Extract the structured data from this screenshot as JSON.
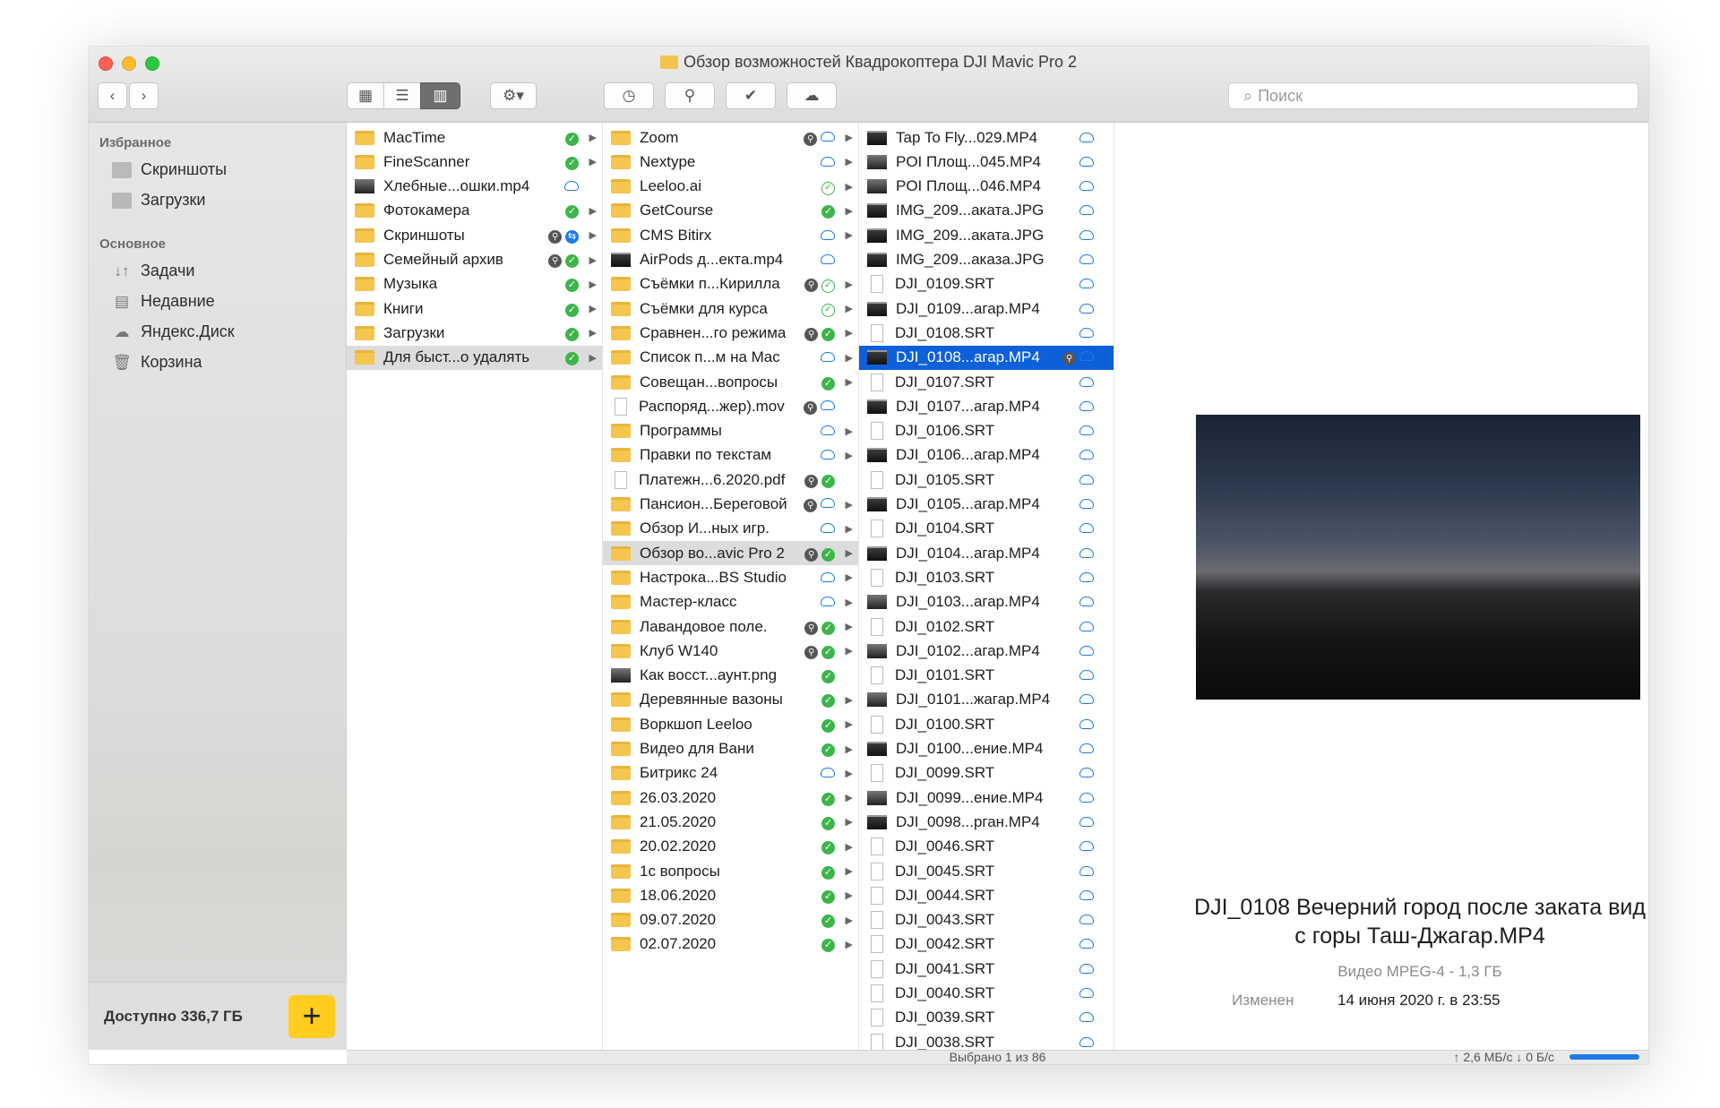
{
  "window": {
    "title": "Обзор возможностей Квадрокоптера DJI Mavic Pro 2"
  },
  "toolbar": {
    "back_icon": "chevron-left-icon",
    "forward_icon": "chevron-right-icon",
    "view_icons": "grid-icon",
    "view_list": "list-icon",
    "view_columns": "columns-icon",
    "action": "gear-icon",
    "search_placeholder": "Поиск"
  },
  "sidebar": {
    "favorites_header": "Избранное",
    "favorites": [
      {
        "label": "Скриншоты"
      },
      {
        "label": "Загрузки"
      }
    ],
    "main_header": "Основное",
    "main": [
      {
        "label": "Задачи",
        "icon": "↓↑"
      },
      {
        "label": "Недавние",
        "icon": "▤"
      },
      {
        "label": "Яндекс.Диск",
        "icon": "☁"
      },
      {
        "label": "Корзина",
        "icon": "🗑"
      }
    ],
    "free_space": "Доступно 336,7 ГБ",
    "add_label": "+"
  },
  "col1": [
    {
      "name": "MacTime",
      "type": "folder",
      "status": "ok",
      "arrow": true
    },
    {
      "name": "FineScanner",
      "type": "folder",
      "status": "ok",
      "arrow": true
    },
    {
      "name": "Хлебные...ошки.mp4",
      "type": "img",
      "status": "cloud",
      "arrow": false
    },
    {
      "name": "Фотокамера",
      "type": "folder",
      "status": "ok",
      "arrow": true
    },
    {
      "name": "Скриншоты",
      "type": "folder",
      "status": "linksync",
      "arrow": true
    },
    {
      "name": "Семейный архив",
      "type": "folder",
      "status": "linkok",
      "arrow": true
    },
    {
      "name": "Музыка",
      "type": "folder",
      "status": "ok",
      "arrow": true
    },
    {
      "name": "Книги",
      "type": "folder",
      "status": "ok",
      "arrow": true
    },
    {
      "name": "Загрузки",
      "type": "folder",
      "status": "ok",
      "arrow": true
    },
    {
      "name": "Для быст...о удалять",
      "type": "folder",
      "status": "ok",
      "arrow": true,
      "selected": true
    }
  ],
  "col2": [
    {
      "name": "Zoom",
      "type": "folder",
      "status": "linkcloud",
      "arrow": true
    },
    {
      "name": "Nextype",
      "type": "folder",
      "status": "cloud",
      "arrow": true
    },
    {
      "name": "Leeloo.ai",
      "type": "folder",
      "status": "okhollow",
      "arrow": true
    },
    {
      "name": "GetCourse",
      "type": "folder",
      "status": "ok",
      "arrow": true
    },
    {
      "name": "CMS Bitirx",
      "type": "folder",
      "status": "cloud",
      "arrow": true
    },
    {
      "name": "AirPods д...екта.mp4",
      "type": "vid",
      "status": "cloud",
      "arrow": false
    },
    {
      "name": "Съёмки п...Кирилла",
      "type": "folder",
      "status": "linkokhollow",
      "arrow": true
    },
    {
      "name": "Съёмки для курса",
      "type": "folder",
      "status": "okhollow",
      "arrow": true
    },
    {
      "name": "Сравнен...го режима",
      "type": "folder",
      "status": "linkok",
      "arrow": true
    },
    {
      "name": "Список п...м на Mac",
      "type": "folder",
      "status": "cloud",
      "arrow": true
    },
    {
      "name": "Совещан...вопросы",
      "type": "folder",
      "status": "ok",
      "arrow": true
    },
    {
      "name": "Распоряд...жер).mov",
      "type": "doc",
      "status": "linkcloud",
      "arrow": false
    },
    {
      "name": "Программы",
      "type": "folder",
      "status": "cloud",
      "arrow": true
    },
    {
      "name": "Правки по текстам",
      "type": "folder",
      "status": "cloud",
      "arrow": true
    },
    {
      "name": "Платежн...6.2020.pdf",
      "type": "doc",
      "status": "linkok",
      "arrow": false
    },
    {
      "name": "Пансион...Береговой",
      "type": "folder",
      "status": "linkcloud",
      "arrow": true
    },
    {
      "name": "Обзор И...ных игр.",
      "type": "folder",
      "status": "cloud",
      "arrow": true
    },
    {
      "name": "Обзор во...avic Pro 2",
      "type": "folder",
      "status": "linkok",
      "arrow": true,
      "selected": true
    },
    {
      "name": "Настрока...BS Studio",
      "type": "folder",
      "status": "cloud",
      "arrow": true
    },
    {
      "name": "Мастер-класс",
      "type": "folder",
      "status": "cloud",
      "arrow": true
    },
    {
      "name": "Лавандовое поле.",
      "type": "folder",
      "status": "linkok",
      "arrow": true
    },
    {
      "name": "Клуб W140",
      "type": "folder",
      "status": "linkok",
      "arrow": true
    },
    {
      "name": "Как восст...аунт.png",
      "type": "img",
      "status": "ok",
      "arrow": false
    },
    {
      "name": "Деревянные вазоны",
      "type": "folder",
      "status": "ok",
      "arrow": true
    },
    {
      "name": "Воркшоп Leeloo",
      "type": "folder",
      "status": "ok",
      "arrow": true
    },
    {
      "name": "Видео для Вани",
      "type": "folder",
      "status": "ok",
      "arrow": true
    },
    {
      "name": "Битрикс 24",
      "type": "folder",
      "status": "cloud",
      "arrow": true
    },
    {
      "name": "26.03.2020",
      "type": "folder",
      "status": "ok",
      "arrow": true
    },
    {
      "name": "21.05.2020",
      "type": "folder",
      "status": "ok",
      "arrow": true
    },
    {
      "name": "20.02.2020",
      "type": "folder",
      "status": "ok",
      "arrow": true
    },
    {
      "name": "1с вопросы",
      "type": "folder",
      "status": "ok",
      "arrow": true
    },
    {
      "name": "18.06.2020",
      "type": "folder",
      "status": "ok",
      "arrow": true
    },
    {
      "name": "09.07.2020",
      "type": "folder",
      "status": "ok",
      "arrow": true
    },
    {
      "name": "02.07.2020",
      "type": "folder",
      "status": "ok",
      "arrow": true
    }
  ],
  "col3": [
    {
      "name": "Tap To Fly...029.MP4",
      "type": "vid",
      "status": "cloud"
    },
    {
      "name": "POI Площ...045.MP4",
      "type": "img",
      "status": "cloud"
    },
    {
      "name": "POI Площ...046.MP4",
      "type": "img",
      "status": "cloud"
    },
    {
      "name": "IMG_209...аката.JPG",
      "type": "vid",
      "status": "cloud"
    },
    {
      "name": "IMG_209...аката.JPG",
      "type": "vid",
      "status": "cloud"
    },
    {
      "name": "IMG_209...аказа.JPG",
      "type": "vid",
      "status": "cloud"
    },
    {
      "name": "DJI_0109.SRT",
      "type": "doc",
      "status": "cloud"
    },
    {
      "name": "DJI_0109...агар.MP4",
      "type": "vid",
      "status": "cloud"
    },
    {
      "name": "DJI_0108.SRT",
      "type": "doc",
      "status": "cloud"
    },
    {
      "name": "DJI_0108...агар.MP4",
      "type": "vid",
      "status": "linkcloud",
      "highlighted": true
    },
    {
      "name": "DJI_0107.SRT",
      "type": "doc",
      "status": "cloud"
    },
    {
      "name": "DJI_0107...агар.MP4",
      "type": "vid",
      "status": "cloud"
    },
    {
      "name": "DJI_0106.SRT",
      "type": "doc",
      "status": "cloud"
    },
    {
      "name": "DJI_0106...агар.MP4",
      "type": "vid",
      "status": "cloud"
    },
    {
      "name": "DJI_0105.SRT",
      "type": "doc",
      "status": "cloud"
    },
    {
      "name": "DJI_0105...агар.MP4",
      "type": "vid",
      "status": "cloud"
    },
    {
      "name": "DJI_0104.SRT",
      "type": "doc",
      "status": "cloud"
    },
    {
      "name": "DJI_0104...агар.MP4",
      "type": "vid",
      "status": "cloud"
    },
    {
      "name": "DJI_0103.SRT",
      "type": "doc",
      "status": "cloud"
    },
    {
      "name": "DJI_0103...агар.MP4",
      "type": "img",
      "status": "cloud"
    },
    {
      "name": "DJI_0102.SRT",
      "type": "doc",
      "status": "cloud"
    },
    {
      "name": "DJI_0102...агар.MP4",
      "type": "img",
      "status": "cloud"
    },
    {
      "name": "DJI_0101.SRT",
      "type": "doc",
      "status": "cloud"
    },
    {
      "name": "DJI_0101...жагар.MP4",
      "type": "img",
      "status": "cloud"
    },
    {
      "name": "DJI_0100.SRT",
      "type": "doc",
      "status": "cloud"
    },
    {
      "name": "DJI_0100...ение.MP4",
      "type": "vid",
      "status": "cloud"
    },
    {
      "name": "DJI_0099.SRT",
      "type": "doc",
      "status": "cloud"
    },
    {
      "name": "DJI_0099...ение.MP4",
      "type": "img",
      "status": "cloud"
    },
    {
      "name": "DJI_0098...рган.MP4",
      "type": "vid",
      "status": "cloud"
    },
    {
      "name": "DJI_0046.SRT",
      "type": "doc",
      "status": "cloud"
    },
    {
      "name": "DJI_0045.SRT",
      "type": "doc",
      "status": "cloud"
    },
    {
      "name": "DJI_0044.SRT",
      "type": "doc",
      "status": "cloud"
    },
    {
      "name": "DJI_0043.SRT",
      "type": "doc",
      "status": "cloud"
    },
    {
      "name": "DJI_0042.SRT",
      "type": "doc",
      "status": "cloud"
    },
    {
      "name": "DJI_0041.SRT",
      "type": "doc",
      "status": "cloud"
    },
    {
      "name": "DJI_0040.SRT",
      "type": "doc",
      "status": "cloud"
    },
    {
      "name": "DJI_0039.SRT",
      "type": "doc",
      "status": "cloud"
    },
    {
      "name": "DJI_0038.SRT",
      "type": "doc",
      "status": "cloud"
    }
  ],
  "preview": {
    "title": "DJI_0108 Вечерний город после заката вид с горы Таш-Джагар.MP4",
    "kind": "Видео MPEG-4 - 1,3 ГБ",
    "modified_label": "Изменен",
    "modified_value": "14 июня 2020 г. в 23:55"
  },
  "statusbar": {
    "selection": "Выбрано 1 из 86",
    "speed": "↑ 2,6 МБ/с  ↓ 0 Б/с"
  }
}
